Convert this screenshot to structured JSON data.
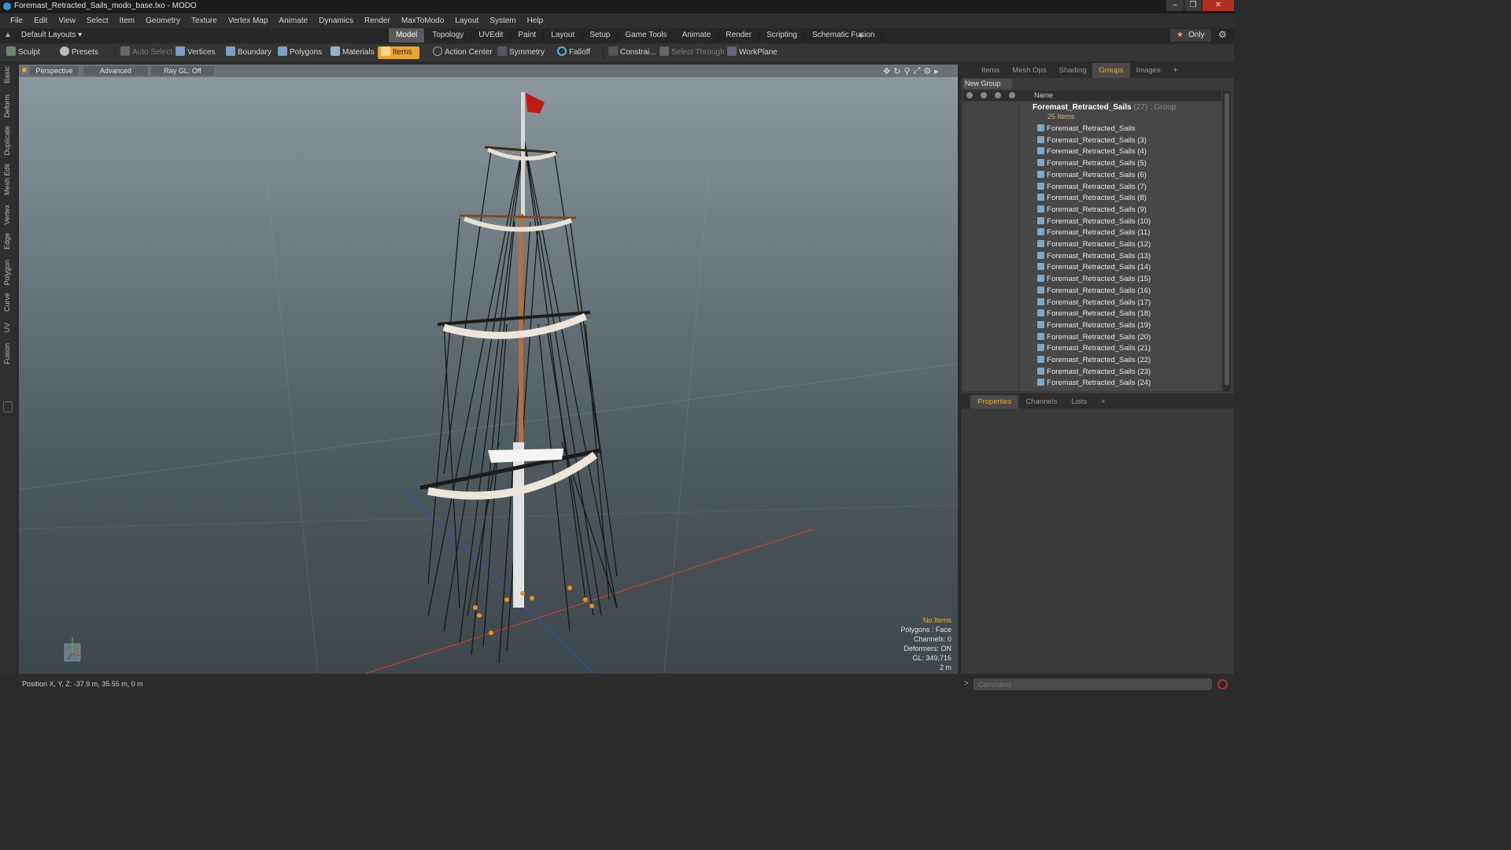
{
  "window": {
    "title": "Foremast_Retracted_Sails_modo_base.lxo - MODO"
  },
  "menu": [
    "File",
    "Edit",
    "View",
    "Select",
    "Item",
    "Geometry",
    "Texture",
    "Vertex Map",
    "Animate",
    "Dynamics",
    "Render",
    "MaxToModo",
    "Layout",
    "System",
    "Help"
  ],
  "layoutbar": {
    "default_layouts": "Default Layouts",
    "tabs": [
      "Model",
      "Topology",
      "UVEdit",
      "Paint",
      "Layout",
      "Setup",
      "Game Tools",
      "Animate",
      "Render",
      "Scripting",
      "Schematic Fusion"
    ],
    "active_tab": "Model",
    "only_label": "Only"
  },
  "toolbar": {
    "sculpt": "Sculpt",
    "presets": "Presets",
    "auto_select": "Auto Select",
    "vertices": "Vertices",
    "boundary": "Boundary",
    "polygons": "Polygons",
    "materials": "Materials",
    "items": "Items",
    "action_center": "Action Center",
    "symmetry": "Symmetry",
    "falloff": "Falloff",
    "constraints": "Constrai...",
    "select_through": "Select Through",
    "workplane": "WorkPlane"
  },
  "left_tabs": [
    "Basic",
    "Deform",
    "Duplicate",
    "Mesh Edit",
    "Vertex",
    "Edge",
    "Polygon",
    "Curve",
    "UV",
    "Fusion"
  ],
  "viewport": {
    "view_mode": "Perspective",
    "shading": "Advanced",
    "raygl": "Ray GL: Off",
    "info": {
      "no_items": "No Items",
      "polygons": "Polygons : Face",
      "channels": "Channels: 0",
      "deformers": "Deformers: ON",
      "gl": "GL: 349,716",
      "scale": "2 m"
    }
  },
  "status": {
    "position": "Position X, Y, Z:  -37.9 m, 35.55 m, 0 m"
  },
  "groups_panel": {
    "tabs": [
      "Items",
      "Mesh Ops",
      "Shading",
      "Groups",
      "Images"
    ],
    "active_tab": "Groups",
    "new_group": "New Group",
    "col_name": "Name",
    "group_name": "Foremast_Retracted_Sails",
    "group_meta": "(27) : Group",
    "group_count": "25 Items",
    "items": [
      "Foremast_Retracted_Sails",
      "Foremast_Retracted_Sails (3)",
      "Foremast_Retracted_Sails (4)",
      "Foremast_Retracted_Sails (5)",
      "Foremast_Retracted_Sails (6)",
      "Foremast_Retracted_Sails (7)",
      "Foremast_Retracted_Sails (8)",
      "Foremast_Retracted_Sails (9)",
      "Foremast_Retracted_Sails (10)",
      "Foremast_Retracted_Sails (11)",
      "Foremast_Retracted_Sails (12)",
      "Foremast_Retracted_Sails (13)",
      "Foremast_Retracted_Sails (14)",
      "Foremast_Retracted_Sails (15)",
      "Foremast_Retracted_Sails (16)",
      "Foremast_Retracted_Sails (17)",
      "Foremast_Retracted_Sails (18)",
      "Foremast_Retracted_Sails (19)",
      "Foremast_Retracted_Sails (20)",
      "Foremast_Retracted_Sails (21)",
      "Foremast_Retracted_Sails (22)",
      "Foremast_Retracted_Sails (23)",
      "Foremast_Retracted_Sails (24)"
    ]
  },
  "properties_panel": {
    "tabs": [
      "Properties",
      "Channels",
      "Lists"
    ],
    "active_tab": "Properties"
  },
  "command": {
    "placeholder": "Command"
  },
  "colors": {
    "accent": "#e8a432",
    "active_tab_text": "#f0a628",
    "flag": "#c01818"
  }
}
